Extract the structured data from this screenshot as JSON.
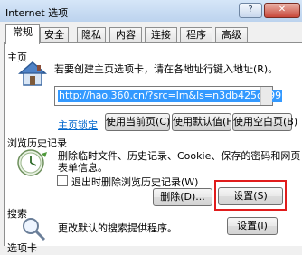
{
  "window": {
    "title": "Internet 选项",
    "help_glyph": "?",
    "close_glyph": "✕"
  },
  "tabs": [
    {
      "label": "常规",
      "active": true
    },
    {
      "label": "安全"
    },
    {
      "label": "隐私"
    },
    {
      "label": "内容"
    },
    {
      "label": "连接"
    },
    {
      "label": "程序"
    },
    {
      "label": "高级"
    }
  ],
  "home": {
    "section_title": "主页",
    "description": "若要创建主页选项卡，请在各地址行键入地址(R)。",
    "url": "http://hao.360.cn/?src=lm&ls=n3db425c399",
    "lock_link": "主页锁定",
    "buttons": {
      "use_current": "使用当前页(C)",
      "use_default": "使用默认值(F)",
      "use_blank": "使用空白页(B)"
    }
  },
  "history": {
    "section_title": "浏览历史记录",
    "description_line1": "删除临时文件、历史记录、Cookie、保存的密码和网页",
    "description_line2": "表单信息。",
    "checkbox_label": "退出时删除浏览历史记录(W)",
    "checkbox_checked": false,
    "buttons": {
      "delete": "删除(D)...",
      "settings": "设置(S)"
    },
    "highlight_color": "#e01c1c"
  },
  "search": {
    "section_title": "搜索",
    "description": "更改默认的搜索提供程序。",
    "settings_button": "设置(I)"
  },
  "tabs_section": {
    "section_title": "选项卡"
  }
}
